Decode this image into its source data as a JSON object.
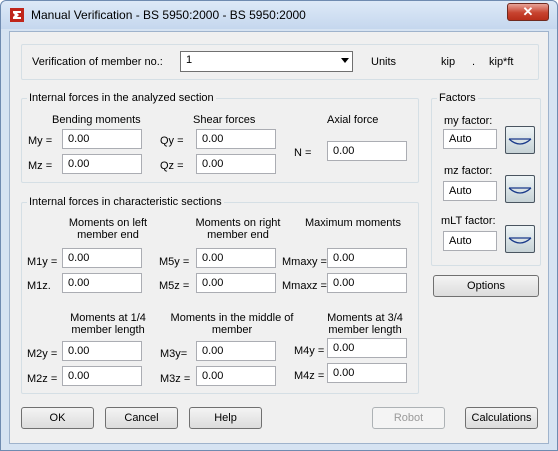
{
  "window": {
    "title": "Manual Verification - BS 5950:2000 - BS 5950:2000",
    "close_label": "✕"
  },
  "member": {
    "label": "Verification of member no.:",
    "value": "1",
    "units_label": "Units",
    "unit_force": "kip",
    "unit_sep": ".",
    "unit_moment": "kip*ft"
  },
  "analyzed": {
    "title": "Internal forces in the analyzed section",
    "bending_header": "Bending moments",
    "shear_header": "Shear forces",
    "axial_header": "Axial force",
    "my_label": "My =",
    "my_value": "0.00",
    "mz_label": "Mz =",
    "mz_value": "0.00",
    "qy_label": "Qy =",
    "qy_value": "0.00",
    "qz_label": "Qz =",
    "qz_value": "0.00",
    "n_label": "N =",
    "n_value": "0.00"
  },
  "characteristic": {
    "title": "Internal forces in characteristic sections",
    "left_header": "Moments on left member end",
    "right_header": "Moments on right member end",
    "max_header": "Maximum moments",
    "m1y_label": "M1y =",
    "m1y_value": "0.00",
    "m1z_label": "M1z.",
    "m1z_value": "0.00",
    "m5y_label": "M5y =",
    "m5y_value": "0.00",
    "m5z_label": "M5z =",
    "m5z_value": "0.00",
    "mmaxy_label": "Mmaxy =",
    "mmaxy_value": "0.00",
    "mmaxz_label": "Mmaxz =",
    "mmaxz_value": "0.00",
    "quarter_header": "Moments at 1/4 member length",
    "middle_header": "Moments in the middle of member",
    "threequarter_header": "Moments at 3/4 member length",
    "m2y_label": "M2y =",
    "m2y_value": "0.00",
    "m2z_label": "M2z =",
    "m2z_value": "0.00",
    "m3y_label": "M3y=",
    "m3y_value": "0.00",
    "m3z_label": "M3z =",
    "m3z_value": "0.00",
    "m4y_label": "M4y =",
    "m4y_value": "0.00",
    "m4z_label": "M4z =",
    "m4z_value": "0.00"
  },
  "factors": {
    "title": "Factors",
    "my_label": "my factor:",
    "my_value": "Auto",
    "mz_label": "mz factor:",
    "mz_value": "Auto",
    "mlt_label": "mLT factor:",
    "mlt_value": "Auto"
  },
  "buttons": {
    "options": "Options",
    "ok": "OK",
    "cancel": "Cancel",
    "help": "Help",
    "robot": "Robot",
    "calculations": "Calculations"
  }
}
